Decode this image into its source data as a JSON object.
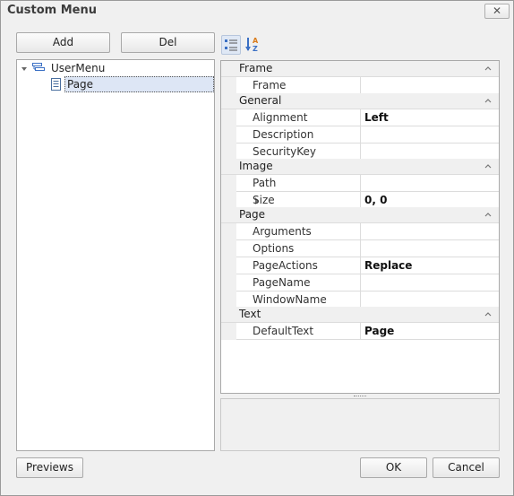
{
  "window": {
    "title": "Custom Menu",
    "close_glyph": "✕"
  },
  "buttons": {
    "add": "Add",
    "del": "Del",
    "previews": "Previews",
    "ok": "OK",
    "cancel": "Cancel"
  },
  "tree": {
    "root": {
      "label": "UserMenu",
      "icon": "menu-icon",
      "expanded": true
    },
    "child": {
      "label": "Page",
      "icon": "page-icon",
      "selected": true
    }
  },
  "grid_toolbar": {
    "categorized_icon": "categorized-icon",
    "alphabetical_icon": "sort-az-icon"
  },
  "property_grid": {
    "categories": [
      {
        "label": "Frame",
        "properties": [
          {
            "name": "Frame",
            "value": ""
          }
        ]
      },
      {
        "label": "General",
        "properties": [
          {
            "name": "Alignment",
            "value": "Left"
          },
          {
            "name": "Description",
            "value": ""
          },
          {
            "name": "SecurityKey",
            "value": ""
          }
        ]
      },
      {
        "label": "Image",
        "properties": [
          {
            "name": "Path",
            "value": ""
          },
          {
            "name": "Size",
            "value": "0, 0"
          }
        ]
      },
      {
        "label": "Page",
        "properties": [
          {
            "name": "Arguments",
            "value": ""
          },
          {
            "name": "Options",
            "value": ""
          },
          {
            "name": "PageActions",
            "value": "Replace"
          },
          {
            "name": "PageName",
            "value": ""
          },
          {
            "name": "WindowName",
            "value": ""
          }
        ]
      },
      {
        "label": "Text",
        "properties": [
          {
            "name": "DefaultText",
            "value": "Page"
          }
        ]
      }
    ]
  },
  "colors": {
    "selection": "#dde6f5",
    "selection_border": "#7f9db9",
    "accent_blue": "#3a6fc4"
  }
}
